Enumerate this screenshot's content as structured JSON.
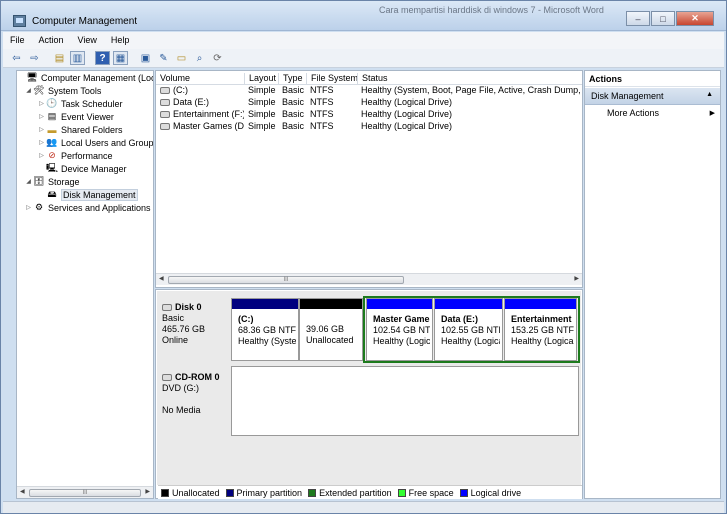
{
  "window": {
    "title": "Computer Management",
    "background_title": "Cara mempartisi harddisk di windows 7 - Microsoft Word",
    "controls": {
      "minimize": "–",
      "maximize": "□",
      "close": "✕"
    }
  },
  "menu": [
    "File",
    "Action",
    "View",
    "Help"
  ],
  "toolbar_icons": [
    "back-icon",
    "forward-icon",
    "up-folder-icon",
    "show-hide-tree-icon",
    "help-icon",
    "show-hide-action-icon",
    "properties-icon",
    "open-icon",
    "search-icon",
    "refresh-icon"
  ],
  "tree": {
    "root": "Computer Management (Local",
    "system_tools": "System Tools",
    "task_scheduler": "Task Scheduler",
    "event_viewer": "Event Viewer",
    "shared_folders": "Shared Folders",
    "local_users": "Local Users and Groups",
    "performance": "Performance",
    "device_manager": "Device Manager",
    "storage": "Storage",
    "disk_management": "Disk Management",
    "services": "Services and Applications"
  },
  "volumes": {
    "headers": {
      "volume": "Volume",
      "layout": "Layout",
      "type": "Type",
      "fs": "File System",
      "status": "Status"
    },
    "rows": [
      {
        "volume": "(C:)",
        "layout": "Simple",
        "type": "Basic",
        "fs": "NTFS",
        "status": "Healthy (System, Boot, Page File, Active, Crash Dump, Prin"
      },
      {
        "volume": "Data (E:)",
        "layout": "Simple",
        "type": "Basic",
        "fs": "NTFS",
        "status": "Healthy (Logical Drive)"
      },
      {
        "volume": "Entertainment (F:)",
        "layout": "Simple",
        "type": "Basic",
        "fs": "NTFS",
        "status": "Healthy (Logical Drive)"
      },
      {
        "volume": "Master Games (D:)",
        "layout": "Simple",
        "type": "Basic",
        "fs": "NTFS",
        "status": "Healthy (Logical Drive)"
      }
    ],
    "scroll_grip": "III"
  },
  "disk0": {
    "name": "Disk 0",
    "type": "Basic",
    "size": "465.76 GB",
    "state": "Online",
    "partitions": [
      {
        "name": "(C:)",
        "size": "68.36 GB NTFS",
        "status": "Healthy (Syster",
        "color": "#00007f"
      },
      {
        "name": "",
        "size": "39.06 GB",
        "status": "Unallocated",
        "color": "#000000"
      },
      {
        "name": "Master Games",
        "size": "102.54 GB NTFS",
        "status": "Healthy (Logica",
        "color": "#0000ff"
      },
      {
        "name": "Data  (E:)",
        "size": "102.55 GB NTFS",
        "status": "Healthy (Logica",
        "color": "#0000ff"
      },
      {
        "name": "Entertainment",
        "size": "153.25 GB NTFS",
        "status": "Healthy (Logical",
        "color": "#0000ff"
      }
    ]
  },
  "cdrom0": {
    "name": "CD-ROM 0",
    "type": "DVD (G:)",
    "media": "No Media"
  },
  "legend": [
    {
      "label": "Unallocated",
      "color": "#000000"
    },
    {
      "label": "Primary partition",
      "color": "#00007f"
    },
    {
      "label": "Extended partition",
      "color": "#1d7a1d"
    },
    {
      "label": "Free space",
      "color": "#33ff33"
    },
    {
      "label": "Logical drive",
      "color": "#0000ff"
    }
  ],
  "actions": {
    "header": "Actions",
    "section": "Disk Management",
    "more": "More Actions"
  },
  "tree_scroll_grip": "III"
}
